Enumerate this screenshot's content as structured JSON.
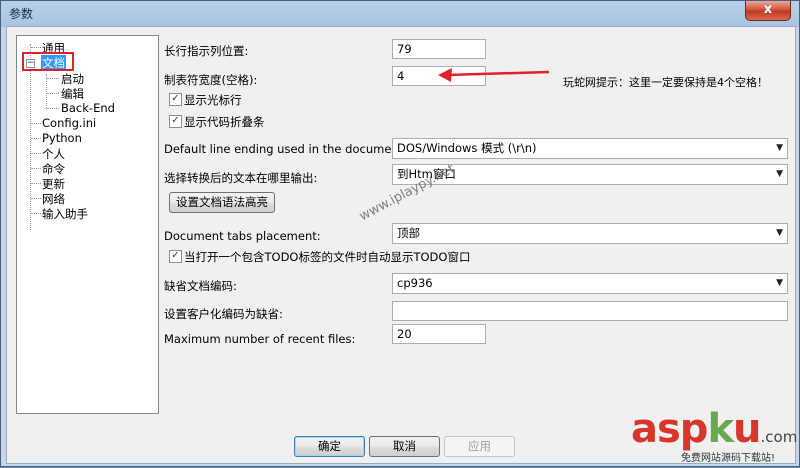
{
  "window": {
    "title": "参数",
    "close_glyph": "x"
  },
  "tree": {
    "items": [
      {
        "label": "通用"
      },
      {
        "label": "文档",
        "expander": "−"
      },
      {
        "label": "启动"
      },
      {
        "label": "编辑"
      },
      {
        "label": "Back-End"
      },
      {
        "label": "Config.ini"
      },
      {
        "label": "Python"
      },
      {
        "label": "个人"
      },
      {
        "label": "命令"
      },
      {
        "label": "更新"
      },
      {
        "label": "网络"
      },
      {
        "label": "输入助手"
      }
    ]
  },
  "settings": {
    "long_line_label": "长行指示列位置:",
    "long_line_value": "79",
    "tab_width_label": "制表符宽度(空格):",
    "tab_width_value": "4",
    "show_cursor_line_label": "显示光标行",
    "show_cursor_line_checked": true,
    "show_fold_label": "显示代码折叠条",
    "show_fold_checked": true,
    "line_ending_label": "Default line ending used in the document:",
    "line_ending_value": "DOS/Windows 模式 (\\r\\n)",
    "output_label": "选择转换后的文本在哪里输出:",
    "output_value": "到Htm窗口",
    "syntax_button": "设置文档语法高亮",
    "tabs_placement_label": "Document tabs placement:",
    "tabs_placement_value": "顶部",
    "todo_label": "当打开一个包含TODO标签的文件时自动显示TODO窗口",
    "todo_checked": true,
    "encoding_label": "缺省文档编码:",
    "encoding_value": "cp936",
    "custom_encoding_label": "设置客户化编码为缺省:",
    "custom_encoding_value": "",
    "recent_files_label": "Maximum number of recent files:",
    "recent_files_value": "20"
  },
  "annotation": {
    "text": "玩蛇网提示：这里一定要保持是4个空格！",
    "color": "#e0202a"
  },
  "buttons": {
    "ok": "确定",
    "cancel": "取消",
    "apply": "应用"
  },
  "watermarks": {
    "diagonal": "www.iplaypy.net",
    "brand_a": "asp",
    "brand_k": "k",
    "brand_u": "u",
    "brand_com": ".com",
    "brand_sub": "免费网站源码下载站!"
  },
  "icons": {
    "checkbox": "check-icon",
    "dropdown": "chevron-down-icon",
    "tree_toggle": "minus-box-icon"
  }
}
